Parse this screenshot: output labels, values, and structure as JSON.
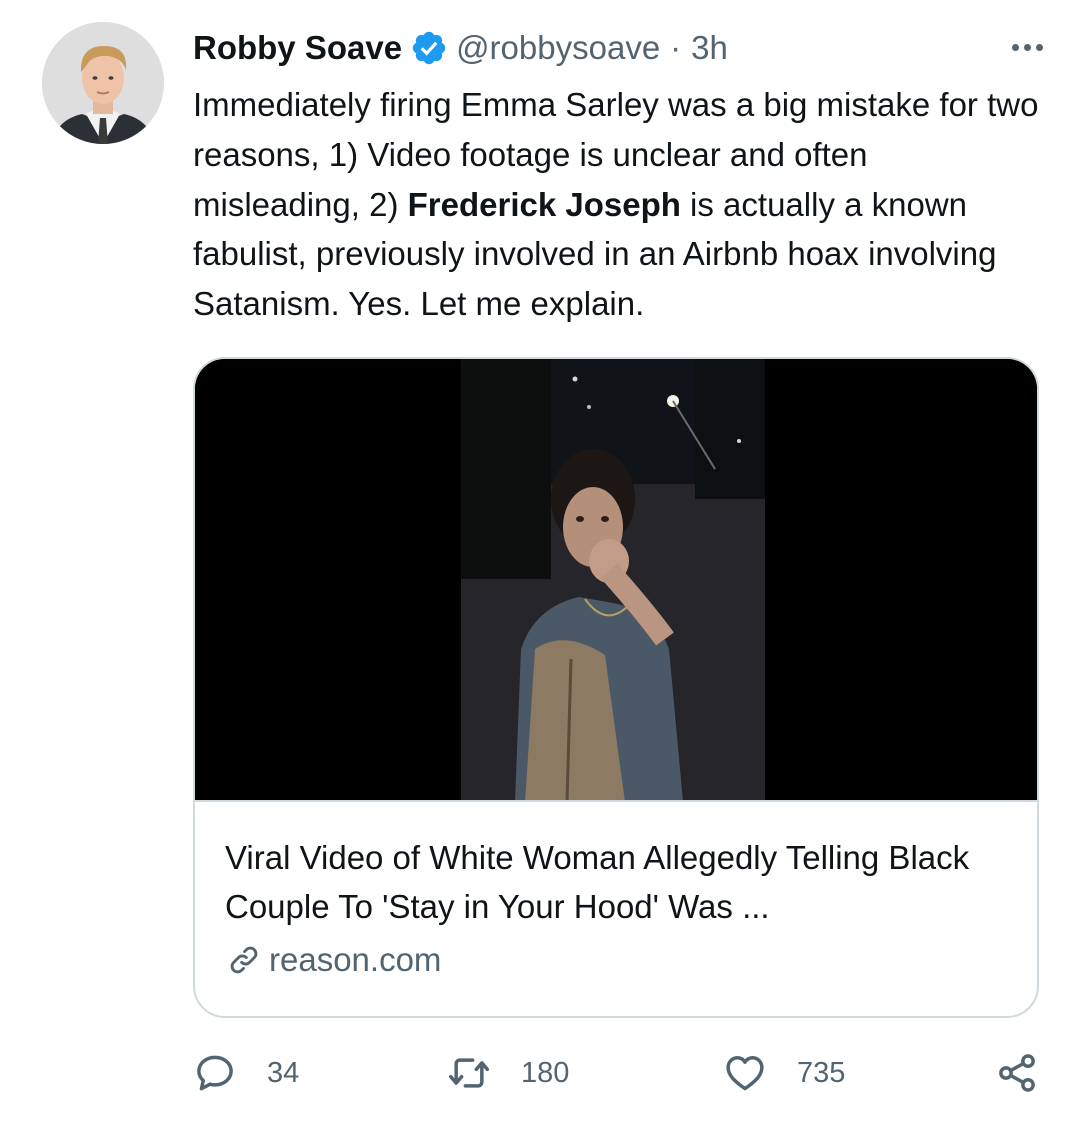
{
  "tweet": {
    "author_name": "Robby Soave",
    "handle": "@robbysoave",
    "separator": "·",
    "time": "3h",
    "text_part1": "Immediately firing Emma Sarley was a big mistake for two reasons, 1) Video footage is unclear and often misleading, 2) ",
    "text_bold": "Frederick Joseph",
    "text_part2": " is actually a known fabulist, previously involved in an Airbnb hoax involving Satanism. Yes. Let me explain."
  },
  "card": {
    "title": "Viral Video of White Woman Allegedly Telling Black Couple To 'Stay in Your Hood' Was ...",
    "domain": "reason.com"
  },
  "actions": {
    "replies": "34",
    "retweets": "180",
    "likes": "735"
  },
  "colors": {
    "verified": "#1d9bf0",
    "secondary_text": "#536471",
    "border": "#cfd9de"
  },
  "icons": [
    "verified-badge-icon",
    "more-icon",
    "link-icon",
    "reply-icon",
    "retweet-icon",
    "like-icon",
    "share-icon"
  ]
}
